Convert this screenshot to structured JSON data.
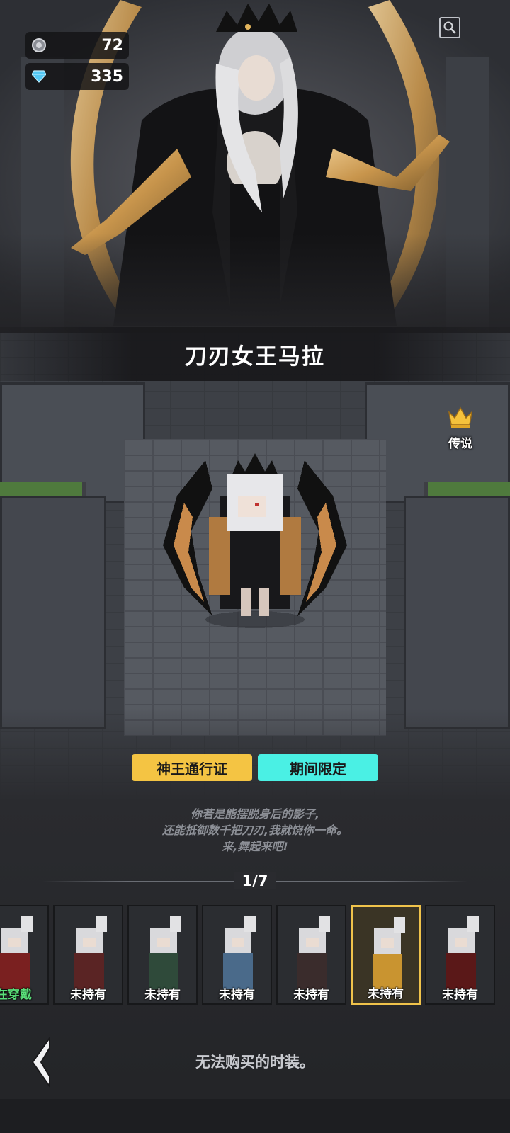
{
  "currency": [
    {
      "icon": "silver-coin-icon",
      "value": "72"
    },
    {
      "icon": "diamond-icon",
      "value": "335"
    }
  ],
  "costume": {
    "name": "刀刃女王马拉",
    "rarity": "传说",
    "tags": [
      "神王通行证",
      "期间限定"
    ],
    "quote": [
      "你若是能摆脱身后的影子,",
      "还能抵御数千把刀刃,我就饶你一命。",
      "来,舞起来吧!"
    ]
  },
  "pager": "1/7",
  "skins": [
    {
      "status": "在穿戴",
      "selected": false,
      "equipped": true
    },
    {
      "status": "未持有",
      "selected": false
    },
    {
      "status": "未持有",
      "selected": false
    },
    {
      "status": "未持有",
      "selected": false
    },
    {
      "status": "未持有",
      "selected": false
    },
    {
      "status": "未持有",
      "selected": true
    },
    {
      "status": "未持有",
      "selected": false
    }
  ],
  "bottom_message": "无法购买的时装。",
  "colors": {
    "gold": "#f4c443",
    "cyan": "#4af0e4",
    "equipped_green": "#5ae07a"
  }
}
